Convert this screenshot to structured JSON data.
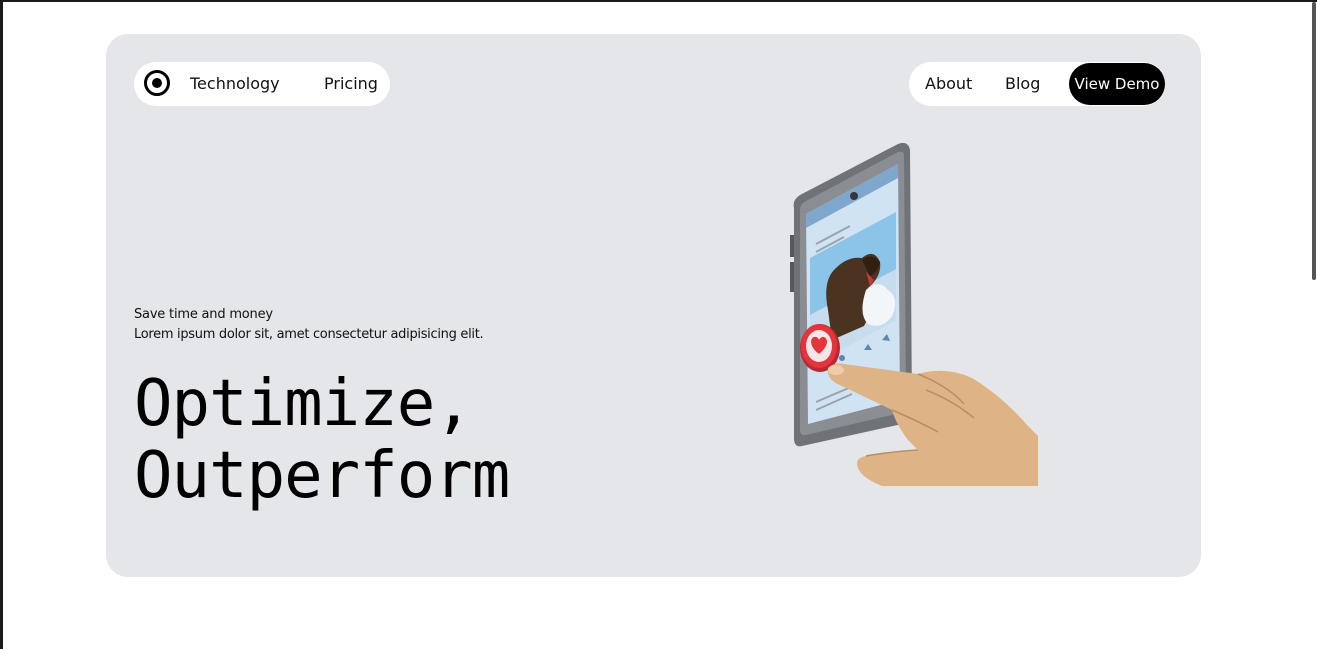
{
  "nav": {
    "left_links": [
      "Technology",
      "Pricing"
    ],
    "right_links": [
      "About",
      "Blog"
    ],
    "cta_label": "View Demo",
    "logo_icon": "circle-dot-icon"
  },
  "hero": {
    "tagline": "Save time and money",
    "subline": "Lorem ipsum dolor sit, amet consectetur adipisicing elit.",
    "headline": [
      "Optimize,",
      "Outperform"
    ]
  },
  "illustration": {
    "icon": "phone-like-illustration",
    "colors": {
      "background": "#e5e6e9",
      "accent": "#e4343d",
      "skin": "#deb386"
    }
  }
}
